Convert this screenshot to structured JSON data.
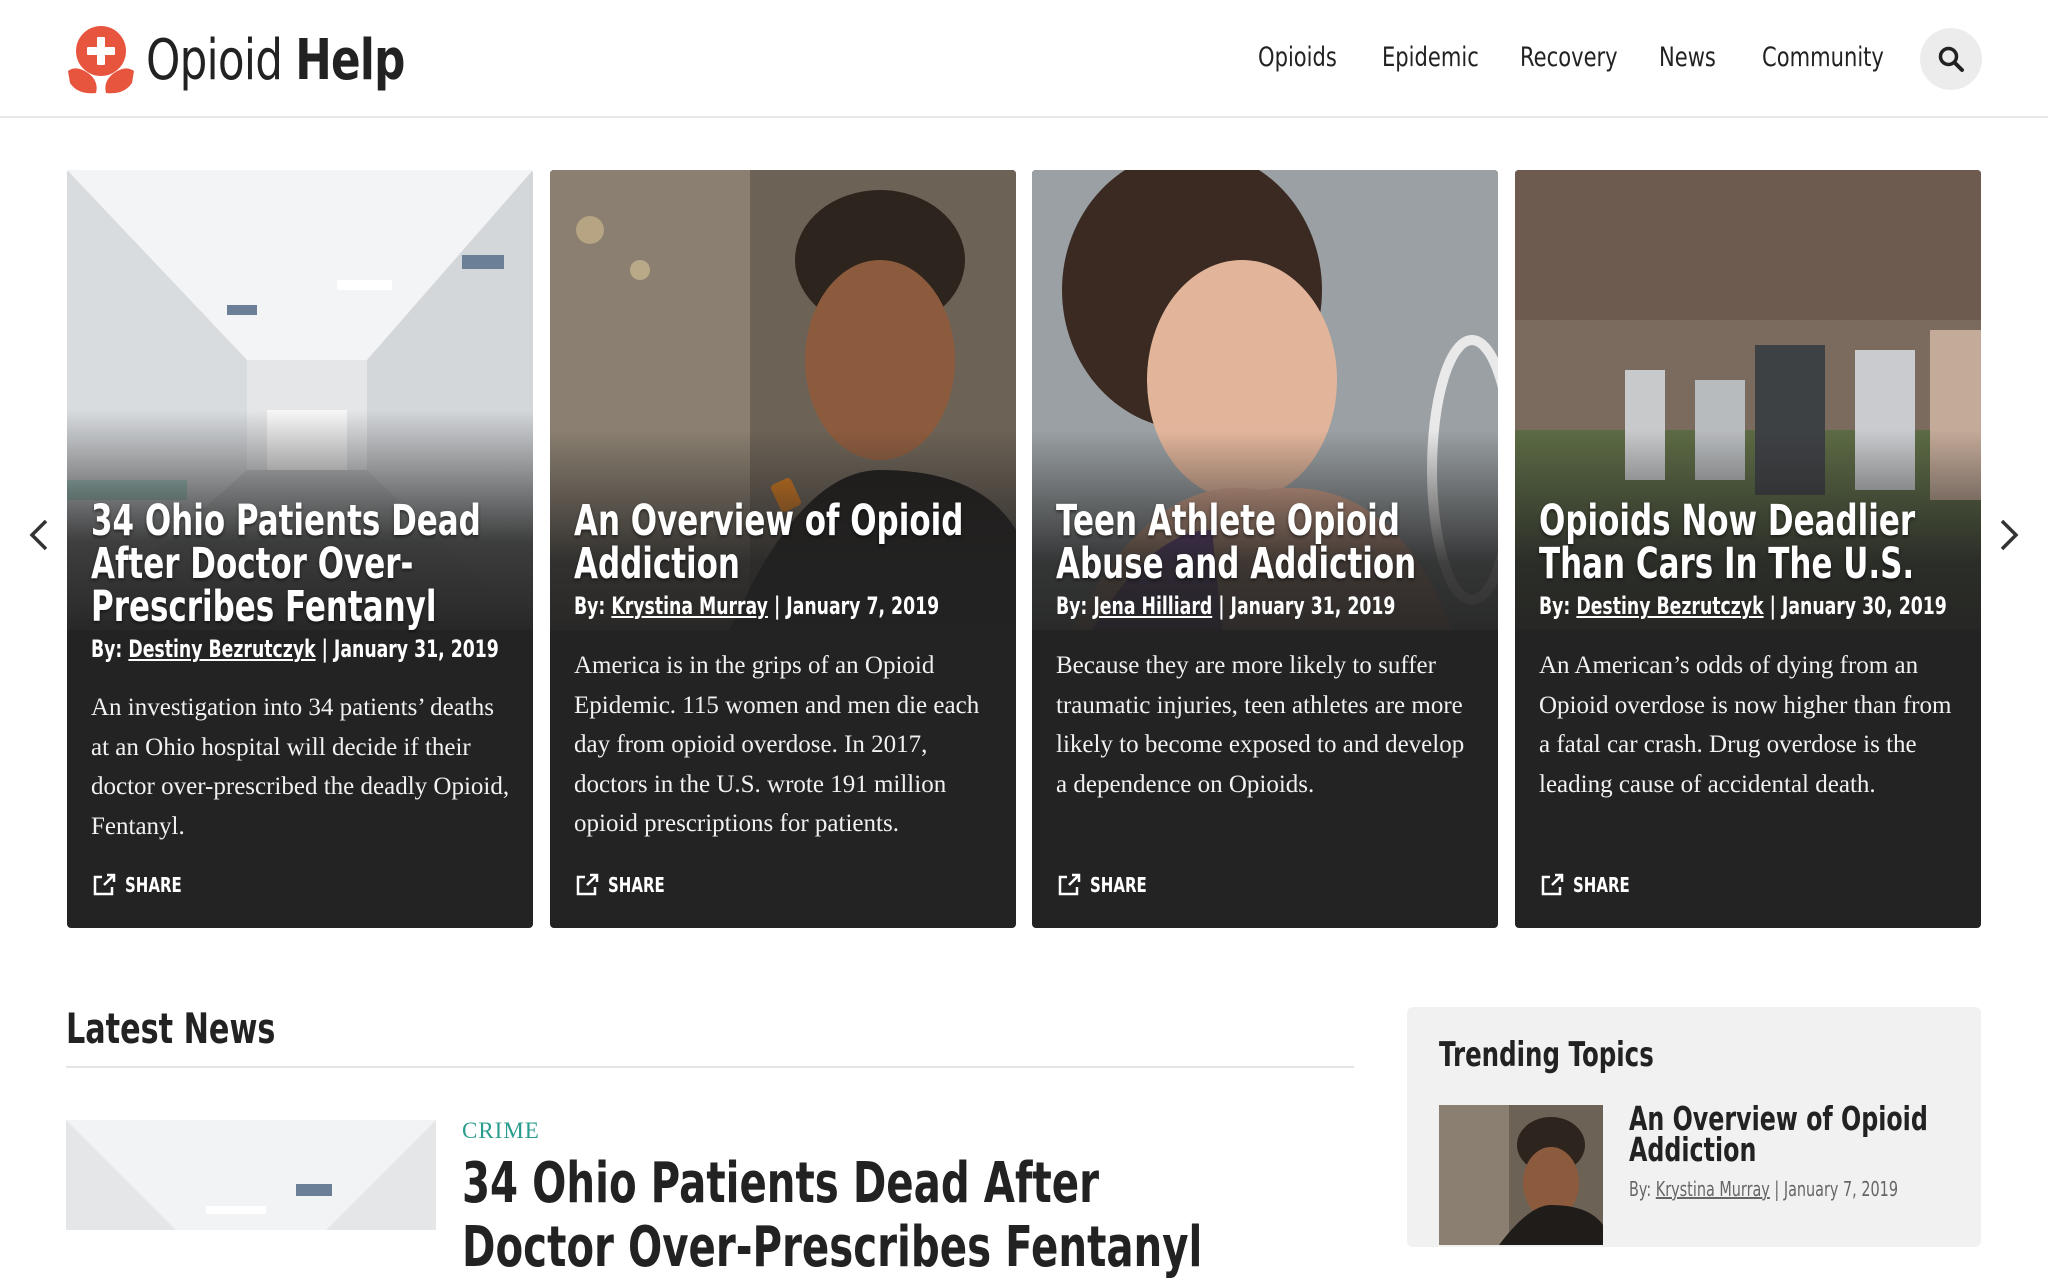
{
  "brand": {
    "name_light": "Opioid",
    "name_bold": "Help",
    "accent": "#e8553e"
  },
  "nav": {
    "items": [
      {
        "label": "Opioids"
      },
      {
        "label": "Epidemic"
      },
      {
        "label": "Recovery"
      },
      {
        "label": "News"
      },
      {
        "label": "Community"
      }
    ],
    "search_icon": "search-icon"
  },
  "carousel": {
    "prev_icon": "chevron-left-icon",
    "next_icon": "chevron-right-icon",
    "cards": [
      {
        "title": "34 Ohio Patients Dead After Doctor Over-Prescribes Fentanyl",
        "by": "By:",
        "author": "Destiny Bezrutczyk",
        "date": "| January 31, 2019",
        "excerpt": "An investigation into 34 patients’ deaths at an Ohio hospital will decide if their doctor over-prescribed the deadly Opioid, Fentanyl.",
        "share_label": "SHARE",
        "image": "hospital-hallway"
      },
      {
        "title": "An Overview of Opioid Addiction",
        "by": "By:",
        "author": "Krystina Murray",
        "date": "| January 7, 2019",
        "excerpt": "America is in the grips of an Opioid Epidemic. 115 women and men die each day from opioid overdose. In 2017, doctors in the U.S. wrote 191 million opioid prescriptions for patients.",
        "share_label": "SHARE",
        "image": "woman-with-pills"
      },
      {
        "title": "Teen Athlete Opioid Abuse and Addiction",
        "by": "By:",
        "author": "Jena Hilliard",
        "date": "| January 31, 2019",
        "excerpt": "Because they are more likely to suffer traumatic injuries, teen athletes are more likely to become exposed to and develop a dependence on Opioids.",
        "share_label": "SHARE",
        "image": "injured-tennis-player"
      },
      {
        "title": "Opioids Now Deadlier Than Cars In The U.S.",
        "by": "By:",
        "author": "Destiny Bezrutczyk",
        "date": "| January 30, 2019",
        "excerpt": "An American’s odds of dying from an Opioid overdose is now higher than from a fatal car crash. Drug overdose is the leading cause of accidental death.",
        "share_label": "SHARE",
        "image": "cemetery"
      }
    ]
  },
  "latest_news": {
    "heading": "Latest News",
    "first": {
      "category": "CRIME",
      "title": "34 Ohio Patients Dead After Doctor Over-Prescribes Fentanyl"
    }
  },
  "trending": {
    "heading": "Trending Topics",
    "first": {
      "title": "An Overview of Opioid Addiction",
      "by": "By:",
      "author": "Krystina Murray",
      "date": "| January 7, 2019"
    }
  }
}
